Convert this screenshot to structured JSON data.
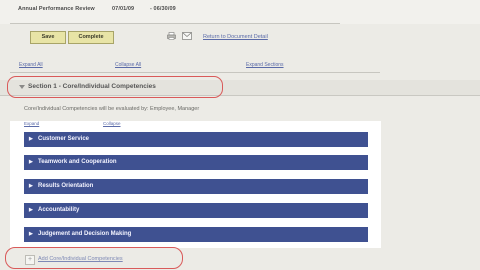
{
  "header": {
    "title": "Annual Performance Review",
    "period_start": "07/01/09",
    "period_end": "- 06/30/09"
  },
  "toolbar": {
    "save_label": "Save",
    "complete_label": "Complete",
    "print_icon": "printer-icon",
    "notify_icon": "mail-icon",
    "return_link": "Return to Document Detail"
  },
  "page_links": {
    "expand_all": "Expand All",
    "collapse_all": "Collapse All",
    "expand_sections": "Expand Sections"
  },
  "section": {
    "title": "Section 1 - Core/Individual Competencies",
    "description": "Core/Individual Competencies will be evaluated by: Employee, Manager",
    "expand_link": "Expand",
    "collapse_link": "Collapse",
    "competencies": [
      {
        "label": "Customer Service"
      },
      {
        "label": "Teamwork and Cooperation"
      },
      {
        "label": "Results Orientation"
      },
      {
        "label": "Accountability"
      },
      {
        "label": "Judgement and Decision Making"
      }
    ],
    "add_link": "Add Core/Individual Competencies"
  },
  "colors": {
    "competency_bar": "#3f5191",
    "button_bg": "#e8e4a6",
    "highlight": "#d95a5a"
  }
}
